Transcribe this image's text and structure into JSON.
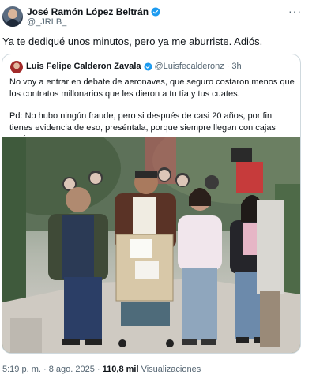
{
  "tweet": {
    "author_name": "José Ramón López Beltrán",
    "handle": "@_JRLB_",
    "more_label": "···",
    "text": "Ya te dediqué unos minutos, pero ya me aburriste. Adiós.",
    "time": "5:19 p. m.",
    "separator": "·",
    "date": "8 ago. 2025",
    "views_count": "110,8 mil",
    "views_label": "Visualizaciones"
  },
  "quote": {
    "author_name": "Luis Felipe Calderon Zavala",
    "handle": "@Luisfecalderonz",
    "separator": "·",
    "time_ago": "3h",
    "paragraph_1": "No voy a entrar en debate de aeronaves, que seguro costaron menos que los contratos millonarios que les dieron a tu tía y tus cuates.",
    "paragraph_2": "Pd: No hubo ningún fraude, pero si después de casi 20 años, por fin tienes evidencia de eso, preséntala, porque siempre llegan con cajas vacías.  ..."
  },
  "colors": {
    "verified_blue": "#1d9bf0",
    "text_primary": "#0f1419",
    "text_secondary": "#536471",
    "border": "#cfd9de"
  },
  "icons": {
    "verified": "verified-badge-icon",
    "more": "more-options-icon"
  }
}
